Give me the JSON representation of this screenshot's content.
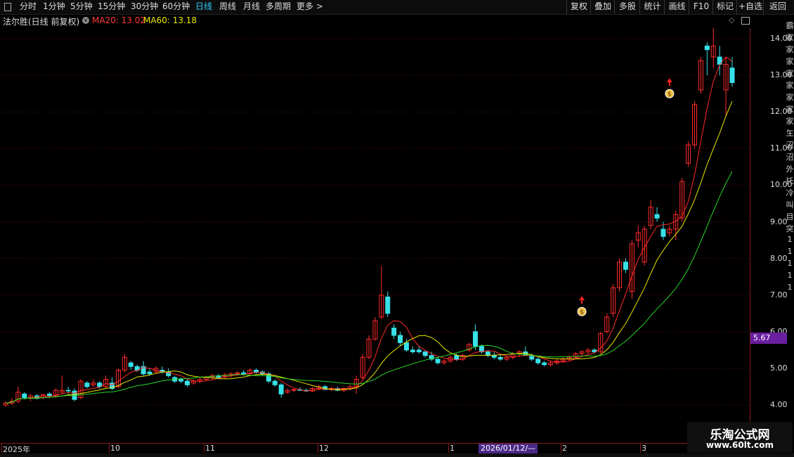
{
  "toolbar": {
    "periods": [
      {
        "label": "分时"
      },
      {
        "label": "1分钟"
      },
      {
        "label": "5分钟"
      },
      {
        "label": "15分钟"
      },
      {
        "label": "30分钟"
      },
      {
        "label": "60分钟"
      },
      {
        "label": "日线",
        "active": true
      },
      {
        "label": "周线"
      },
      {
        "label": "月线"
      },
      {
        "label": "多周期"
      },
      {
        "label": "更多 >"
      }
    ],
    "right_buttons": [
      "复权",
      "叠加",
      "多股",
      "统计",
      "画线",
      "F10",
      "标记",
      "+自选",
      "返回"
    ]
  },
  "chart_header": {
    "title": "法尔胜(日线 前复权)",
    "ma20": "MA20: 13.02",
    "ma60": "MA60: 13.18"
  },
  "colors": {
    "up": "#ff2a2a",
    "down": "#38e0e8",
    "ma_a": "#ffffff",
    "ma_b": "#e8e800",
    "ma_c": "#27d627",
    "grid": "#6b1010"
  },
  "y_axis": {
    "ticks": [
      "14.00",
      "13.00",
      "12.00",
      "11.00",
      "10.00",
      "9.00",
      "8.00",
      "7.00",
      "6.00",
      "5.00",
      "4.00"
    ]
  },
  "price_tag": "5.67",
  "date_axis": {
    "labels": [
      "2025年",
      "10",
      "11",
      "12",
      "1",
      "2",
      "3"
    ],
    "cursor_date": "2026/01/12/—"
  },
  "side_strip": [
    "霸",
    "家",
    "家",
    "家",
    "家",
    "家",
    "家",
    "家",
    "家",
    "玍",
    "沼",
    "沼",
    "外",
    "托",
    "冷",
    "叫",
    "目",
    "突",
    "1",
    "1",
    "1",
    "1",
    "1"
  ],
  "watermark": {
    "title": "乐淘公式网",
    "url": "www.60lt.com"
  },
  "chart_data": {
    "type": "candlestick",
    "title": "法尔胜(日线 前复权)",
    "ylim": [
      3.8,
      14.3
    ],
    "x": [
      "2025年",
      "10",
      "11",
      "12",
      "1",
      "2",
      "3"
    ],
    "candles": [
      {
        "o": 4.0,
        "h": 4.1,
        "l": 3.95,
        "c": 4.05
      },
      {
        "o": 4.05,
        "h": 4.2,
        "l": 4.0,
        "c": 4.1
      },
      {
        "o": 4.1,
        "h": 4.5,
        "l": 4.05,
        "c": 4.35
      },
      {
        "o": 4.3,
        "h": 4.35,
        "l": 4.15,
        "c": 4.2
      },
      {
        "o": 4.2,
        "h": 4.3,
        "l": 4.1,
        "c": 4.25
      },
      {
        "o": 4.25,
        "h": 4.3,
        "l": 4.15,
        "c": 4.18
      },
      {
        "o": 4.2,
        "h": 4.3,
        "l": 4.15,
        "c": 4.28
      },
      {
        "o": 4.3,
        "h": 4.35,
        "l": 4.2,
        "c": 4.25
      },
      {
        "o": 4.25,
        "h": 4.45,
        "l": 4.2,
        "c": 4.4
      },
      {
        "o": 4.35,
        "h": 4.8,
        "l": 4.3,
        "c": 4.4
      },
      {
        "o": 4.4,
        "h": 4.5,
        "l": 4.3,
        "c": 4.38
      },
      {
        "o": 4.38,
        "h": 4.45,
        "l": 4.1,
        "c": 4.15
      },
      {
        "o": 4.2,
        "h": 4.7,
        "l": 4.15,
        "c": 4.65
      },
      {
        "o": 4.6,
        "h": 4.65,
        "l": 4.45,
        "c": 4.5
      },
      {
        "o": 4.55,
        "h": 4.7,
        "l": 4.5,
        "c": 4.6
      },
      {
        "o": 4.6,
        "h": 4.65,
        "l": 4.45,
        "c": 4.5
      },
      {
        "o": 4.5,
        "h": 4.8,
        "l": 4.45,
        "c": 4.7
      },
      {
        "o": 4.6,
        "h": 4.75,
        "l": 4.4,
        "c": 4.45
      },
      {
        "o": 4.5,
        "h": 5.0,
        "l": 4.45,
        "c": 4.95
      },
      {
        "o": 4.95,
        "h": 5.4,
        "l": 4.9,
        "c": 5.3
      },
      {
        "o": 5.15,
        "h": 5.2,
        "l": 4.95,
        "c": 5.05
      },
      {
        "o": 5.05,
        "h": 5.1,
        "l": 4.9,
        "c": 4.95
      },
      {
        "o": 5.05,
        "h": 5.2,
        "l": 4.8,
        "c": 4.85
      },
      {
        "o": 4.9,
        "h": 5.0,
        "l": 4.8,
        "c": 4.85
      },
      {
        "o": 4.9,
        "h": 5.05,
        "l": 4.85,
        "c": 5.0
      },
      {
        "o": 4.95,
        "h": 5.05,
        "l": 4.85,
        "c": 4.9
      },
      {
        "o": 4.9,
        "h": 5.0,
        "l": 4.75,
        "c": 4.8
      },
      {
        "o": 4.75,
        "h": 4.8,
        "l": 4.6,
        "c": 4.65
      },
      {
        "o": 4.7,
        "h": 4.75,
        "l": 4.6,
        "c": 4.65
      },
      {
        "o": 4.65,
        "h": 4.7,
        "l": 4.5,
        "c": 4.55
      },
      {
        "o": 4.6,
        "h": 4.7,
        "l": 4.55,
        "c": 4.65
      },
      {
        "o": 4.65,
        "h": 4.75,
        "l": 4.6,
        "c": 4.7
      },
      {
        "o": 4.7,
        "h": 4.8,
        "l": 4.65,
        "c": 4.75
      },
      {
        "o": 4.75,
        "h": 4.85,
        "l": 4.7,
        "c": 4.8
      },
      {
        "o": 4.8,
        "h": 4.85,
        "l": 4.7,
        "c": 4.75
      },
      {
        "o": 4.78,
        "h": 4.88,
        "l": 4.72,
        "c": 4.82
      },
      {
        "o": 4.82,
        "h": 4.9,
        "l": 4.75,
        "c": 4.85
      },
      {
        "o": 4.85,
        "h": 4.92,
        "l": 4.8,
        "c": 4.88
      },
      {
        "o": 4.88,
        "h": 4.95,
        "l": 4.8,
        "c": 4.85
      },
      {
        "o": 4.85,
        "h": 5.0,
        "l": 4.8,
        "c": 4.95
      },
      {
        "o": 4.95,
        "h": 5.0,
        "l": 4.85,
        "c": 4.9
      },
      {
        "o": 4.9,
        "h": 4.95,
        "l": 4.8,
        "c": 4.85
      },
      {
        "o": 4.85,
        "h": 4.9,
        "l": 4.6,
        "c": 4.65
      },
      {
        "o": 4.65,
        "h": 4.7,
        "l": 4.5,
        "c": 4.55
      },
      {
        "o": 4.55,
        "h": 4.6,
        "l": 4.2,
        "c": 4.3
      },
      {
        "o": 4.35,
        "h": 4.45,
        "l": 4.3,
        "c": 4.4
      },
      {
        "o": 4.4,
        "h": 4.45,
        "l": 4.35,
        "c": 4.42
      },
      {
        "o": 4.42,
        "h": 4.48,
        "l": 4.38,
        "c": 4.4
      },
      {
        "o": 4.4,
        "h": 4.45,
        "l": 4.35,
        "c": 4.38
      },
      {
        "o": 4.38,
        "h": 4.5,
        "l": 4.35,
        "c": 4.45
      },
      {
        "o": 4.45,
        "h": 4.55,
        "l": 4.4,
        "c": 4.5
      },
      {
        "o": 4.5,
        "h": 4.55,
        "l": 4.4,
        "c": 4.42
      },
      {
        "o": 4.42,
        "h": 4.5,
        "l": 4.38,
        "c": 4.45
      },
      {
        "o": 4.45,
        "h": 4.5,
        "l": 4.38,
        "c": 4.4
      },
      {
        "o": 4.4,
        "h": 4.48,
        "l": 4.35,
        "c": 4.45
      },
      {
        "o": 4.45,
        "h": 4.55,
        "l": 4.4,
        "c": 4.5
      },
      {
        "o": 4.5,
        "h": 4.8,
        "l": 4.3,
        "c": 4.7
      },
      {
        "o": 4.75,
        "h": 5.4,
        "l": 4.7,
        "c": 5.3
      },
      {
        "o": 5.3,
        "h": 5.9,
        "l": 5.25,
        "c": 5.8
      },
      {
        "o": 5.8,
        "h": 6.4,
        "l": 5.75,
        "c": 6.3
      },
      {
        "o": 6.4,
        "h": 7.8,
        "l": 6.35,
        "c": 7.0
      },
      {
        "o": 6.95,
        "h": 7.1,
        "l": 6.4,
        "c": 6.5
      },
      {
        "o": 6.1,
        "h": 6.2,
        "l": 5.8,
        "c": 5.9
      },
      {
        "o": 5.9,
        "h": 6.0,
        "l": 5.6,
        "c": 5.7
      },
      {
        "o": 5.7,
        "h": 5.8,
        "l": 5.45,
        "c": 5.5
      },
      {
        "o": 5.5,
        "h": 5.6,
        "l": 5.4,
        "c": 5.45
      },
      {
        "o": 5.5,
        "h": 5.6,
        "l": 5.4,
        "c": 5.45
      },
      {
        "o": 5.45,
        "h": 5.5,
        "l": 5.3,
        "c": 5.35
      },
      {
        "o": 5.35,
        "h": 5.45,
        "l": 5.2,
        "c": 5.25
      },
      {
        "o": 5.25,
        "h": 5.3,
        "l": 5.1,
        "c": 5.15
      },
      {
        "o": 5.15,
        "h": 5.25,
        "l": 5.1,
        "c": 5.2
      },
      {
        "o": 5.2,
        "h": 5.35,
        "l": 5.15,
        "c": 5.3
      },
      {
        "o": 5.35,
        "h": 5.4,
        "l": 5.2,
        "c": 5.25
      },
      {
        "o": 5.25,
        "h": 5.4,
        "l": 5.2,
        "c": 5.35
      },
      {
        "o": 5.5,
        "h": 5.7,
        "l": 5.45,
        "c": 5.65
      },
      {
        "o": 6.0,
        "h": 6.2,
        "l": 5.5,
        "c": 5.6
      },
      {
        "o": 5.6,
        "h": 5.65,
        "l": 5.4,
        "c": 5.45
      },
      {
        "o": 5.45,
        "h": 5.5,
        "l": 5.3,
        "c": 5.35
      },
      {
        "o": 5.35,
        "h": 5.45,
        "l": 5.25,
        "c": 5.3
      },
      {
        "o": 5.3,
        "h": 5.4,
        "l": 5.2,
        "c": 5.25
      },
      {
        "o": 5.25,
        "h": 5.35,
        "l": 5.2,
        "c": 5.3
      },
      {
        "o": 5.3,
        "h": 5.45,
        "l": 5.25,
        "c": 5.4
      },
      {
        "o": 5.4,
        "h": 5.5,
        "l": 5.3,
        "c": 5.45
      },
      {
        "o": 5.45,
        "h": 5.6,
        "l": 5.4,
        "c": 5.35
      },
      {
        "o": 5.35,
        "h": 5.4,
        "l": 5.2,
        "c": 5.25
      },
      {
        "o": 5.25,
        "h": 5.3,
        "l": 5.1,
        "c": 5.15
      },
      {
        "o": 5.15,
        "h": 5.2,
        "l": 5.05,
        "c": 5.1
      },
      {
        "o": 5.1,
        "h": 5.2,
        "l": 5.05,
        "c": 5.15
      },
      {
        "o": 5.15,
        "h": 5.25,
        "l": 5.1,
        "c": 5.2
      },
      {
        "o": 5.2,
        "h": 5.3,
        "l": 5.15,
        "c": 5.25
      },
      {
        "o": 5.25,
        "h": 5.35,
        "l": 5.2,
        "c": 5.3
      },
      {
        "o": 5.3,
        "h": 5.45,
        "l": 5.25,
        "c": 5.4
      },
      {
        "o": 5.4,
        "h": 5.5,
        "l": 5.35,
        "c": 5.45
      },
      {
        "o": 5.45,
        "h": 5.55,
        "l": 5.4,
        "c": 5.5
      },
      {
        "o": 5.5,
        "h": 5.55,
        "l": 5.4,
        "c": 5.45
      },
      {
        "o": 5.45,
        "h": 6.0,
        "l": 5.4,
        "c": 5.95
      },
      {
        "o": 6.0,
        "h": 6.5,
        "l": 5.95,
        "c": 6.4
      },
      {
        "o": 6.5,
        "h": 7.3,
        "l": 6.4,
        "c": 7.2
      },
      {
        "o": 7.2,
        "h": 8.0,
        "l": 7.1,
        "c": 7.9
      },
      {
        "o": 7.9,
        "h": 8.0,
        "l": 7.6,
        "c": 7.7
      },
      {
        "o": 7.1,
        "h": 8.5,
        "l": 6.9,
        "c": 8.4
      },
      {
        "o": 8.5,
        "h": 8.9,
        "l": 8.3,
        "c": 8.7
      },
      {
        "o": 7.9,
        "h": 8.9,
        "l": 7.8,
        "c": 8.8
      },
      {
        "o": 8.9,
        "h": 9.6,
        "l": 8.8,
        "c": 9.4
      },
      {
        "o": 9.2,
        "h": 9.4,
        "l": 9.0,
        "c": 9.1
      },
      {
        "o": 8.8,
        "h": 9.0,
        "l": 8.5,
        "c": 8.6
      },
      {
        "o": 8.7,
        "h": 8.9,
        "l": 8.6,
        "c": 8.8
      },
      {
        "o": 8.8,
        "h": 9.3,
        "l": 8.5,
        "c": 9.2
      },
      {
        "o": 9.1,
        "h": 10.2,
        "l": 9.0,
        "c": 10.1
      },
      {
        "o": 10.6,
        "h": 11.2,
        "l": 10.5,
        "c": 11.1
      },
      {
        "o": 11.1,
        "h": 12.3,
        "l": 11.0,
        "c": 12.2
      },
      {
        "o": 12.6,
        "h": 13.5,
        "l": 12.5,
        "c": 13.4
      },
      {
        "o": 13.8,
        "h": 13.9,
        "l": 13.0,
        "c": 13.7
      },
      {
        "o": 13.5,
        "h": 14.3,
        "l": 13.2,
        "c": 13.8
      },
      {
        "o": 13.5,
        "h": 13.8,
        "l": 13.0,
        "c": 13.3
      },
      {
        "o": 12.6,
        "h": 13.5,
        "l": 11.9,
        "c": 13.3
      },
      {
        "o": 13.2,
        "h": 13.5,
        "l": 12.7,
        "c": 12.8
      }
    ]
  }
}
